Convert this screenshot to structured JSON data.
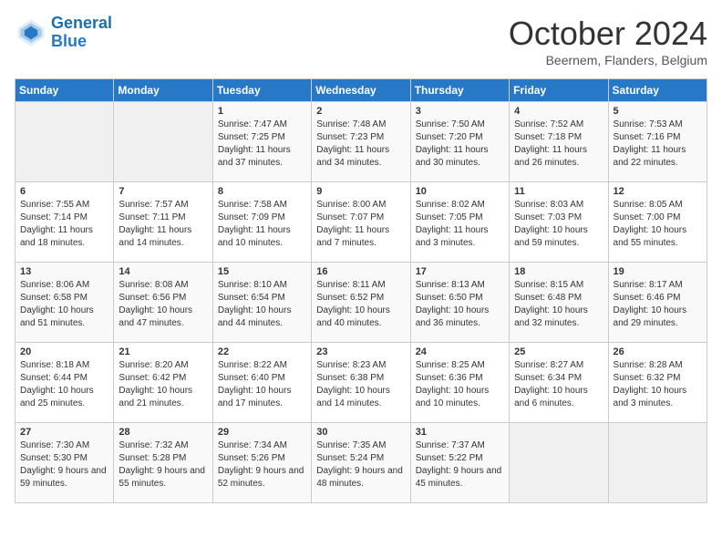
{
  "header": {
    "logo_line1": "General",
    "logo_line2": "Blue",
    "month": "October 2024",
    "location": "Beernem, Flanders, Belgium"
  },
  "days_of_week": [
    "Sunday",
    "Monday",
    "Tuesday",
    "Wednesday",
    "Thursday",
    "Friday",
    "Saturday"
  ],
  "weeks": [
    [
      {
        "day": "",
        "content": ""
      },
      {
        "day": "",
        "content": ""
      },
      {
        "day": "1",
        "content": "Sunrise: 7:47 AM\nSunset: 7:25 PM\nDaylight: 11 hours\nand 37 minutes."
      },
      {
        "day": "2",
        "content": "Sunrise: 7:48 AM\nSunset: 7:23 PM\nDaylight: 11 hours\nand 34 minutes."
      },
      {
        "day": "3",
        "content": "Sunrise: 7:50 AM\nSunset: 7:20 PM\nDaylight: 11 hours\nand 30 minutes."
      },
      {
        "day": "4",
        "content": "Sunrise: 7:52 AM\nSunset: 7:18 PM\nDaylight: 11 hours\nand 26 minutes."
      },
      {
        "day": "5",
        "content": "Sunrise: 7:53 AM\nSunset: 7:16 PM\nDaylight: 11 hours\nand 22 minutes."
      }
    ],
    [
      {
        "day": "6",
        "content": "Sunrise: 7:55 AM\nSunset: 7:14 PM\nDaylight: 11 hours\nand 18 minutes."
      },
      {
        "day": "7",
        "content": "Sunrise: 7:57 AM\nSunset: 7:11 PM\nDaylight: 11 hours\nand 14 minutes."
      },
      {
        "day": "8",
        "content": "Sunrise: 7:58 AM\nSunset: 7:09 PM\nDaylight: 11 hours\nand 10 minutes."
      },
      {
        "day": "9",
        "content": "Sunrise: 8:00 AM\nSunset: 7:07 PM\nDaylight: 11 hours\nand 7 minutes."
      },
      {
        "day": "10",
        "content": "Sunrise: 8:02 AM\nSunset: 7:05 PM\nDaylight: 11 hours\nand 3 minutes."
      },
      {
        "day": "11",
        "content": "Sunrise: 8:03 AM\nSunset: 7:03 PM\nDaylight: 10 hours\nand 59 minutes."
      },
      {
        "day": "12",
        "content": "Sunrise: 8:05 AM\nSunset: 7:00 PM\nDaylight: 10 hours\nand 55 minutes."
      }
    ],
    [
      {
        "day": "13",
        "content": "Sunrise: 8:06 AM\nSunset: 6:58 PM\nDaylight: 10 hours\nand 51 minutes."
      },
      {
        "day": "14",
        "content": "Sunrise: 8:08 AM\nSunset: 6:56 PM\nDaylight: 10 hours\nand 47 minutes."
      },
      {
        "day": "15",
        "content": "Sunrise: 8:10 AM\nSunset: 6:54 PM\nDaylight: 10 hours\nand 44 minutes."
      },
      {
        "day": "16",
        "content": "Sunrise: 8:11 AM\nSunset: 6:52 PM\nDaylight: 10 hours\nand 40 minutes."
      },
      {
        "day": "17",
        "content": "Sunrise: 8:13 AM\nSunset: 6:50 PM\nDaylight: 10 hours\nand 36 minutes."
      },
      {
        "day": "18",
        "content": "Sunrise: 8:15 AM\nSunset: 6:48 PM\nDaylight: 10 hours\nand 32 minutes."
      },
      {
        "day": "19",
        "content": "Sunrise: 8:17 AM\nSunset: 6:46 PM\nDaylight: 10 hours\nand 29 minutes."
      }
    ],
    [
      {
        "day": "20",
        "content": "Sunrise: 8:18 AM\nSunset: 6:44 PM\nDaylight: 10 hours\nand 25 minutes."
      },
      {
        "day": "21",
        "content": "Sunrise: 8:20 AM\nSunset: 6:42 PM\nDaylight: 10 hours\nand 21 minutes."
      },
      {
        "day": "22",
        "content": "Sunrise: 8:22 AM\nSunset: 6:40 PM\nDaylight: 10 hours\nand 17 minutes."
      },
      {
        "day": "23",
        "content": "Sunrise: 8:23 AM\nSunset: 6:38 PM\nDaylight: 10 hours\nand 14 minutes."
      },
      {
        "day": "24",
        "content": "Sunrise: 8:25 AM\nSunset: 6:36 PM\nDaylight: 10 hours\nand 10 minutes."
      },
      {
        "day": "25",
        "content": "Sunrise: 8:27 AM\nSunset: 6:34 PM\nDaylight: 10 hours\nand 6 minutes."
      },
      {
        "day": "26",
        "content": "Sunrise: 8:28 AM\nSunset: 6:32 PM\nDaylight: 10 hours\nand 3 minutes."
      }
    ],
    [
      {
        "day": "27",
        "content": "Sunrise: 7:30 AM\nSunset: 5:30 PM\nDaylight: 9 hours\nand 59 minutes."
      },
      {
        "day": "28",
        "content": "Sunrise: 7:32 AM\nSunset: 5:28 PM\nDaylight: 9 hours\nand 55 minutes."
      },
      {
        "day": "29",
        "content": "Sunrise: 7:34 AM\nSunset: 5:26 PM\nDaylight: 9 hours\nand 52 minutes."
      },
      {
        "day": "30",
        "content": "Sunrise: 7:35 AM\nSunset: 5:24 PM\nDaylight: 9 hours\nand 48 minutes."
      },
      {
        "day": "31",
        "content": "Sunrise: 7:37 AM\nSunset: 5:22 PM\nDaylight: 9 hours\nand 45 minutes."
      },
      {
        "day": "",
        "content": ""
      },
      {
        "day": "",
        "content": ""
      }
    ]
  ]
}
